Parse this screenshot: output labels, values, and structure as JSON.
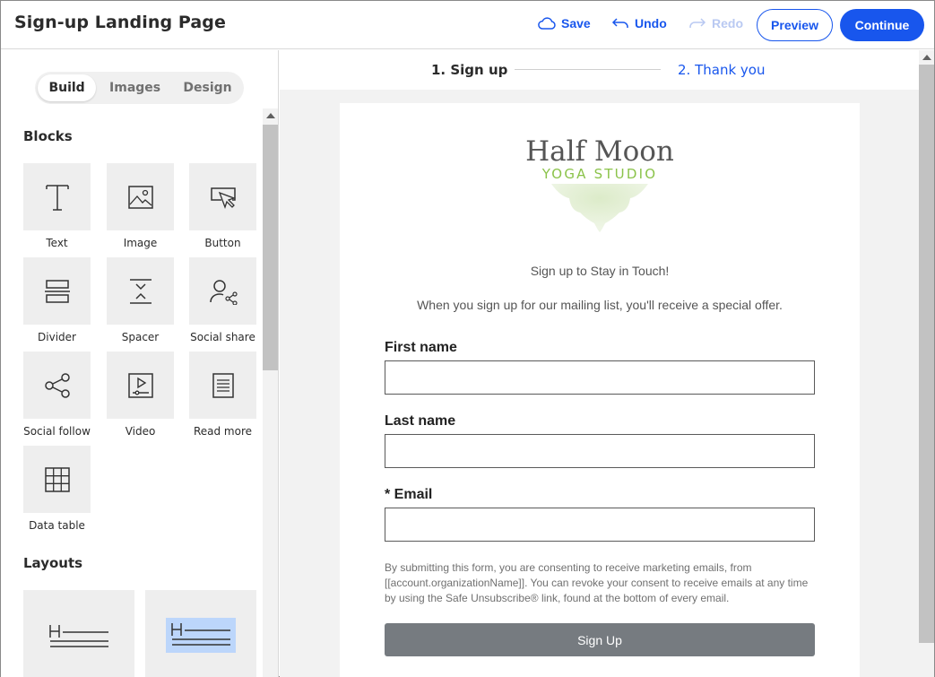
{
  "header": {
    "title": "Sign-up Landing Page",
    "save_label": "Save",
    "undo_label": "Undo",
    "redo_label": "Redo",
    "preview_label": "Preview",
    "continue_label": "Continue",
    "accent_color": "#1856ed"
  },
  "sidebar": {
    "tabs": [
      {
        "label": "Build",
        "active": true
      },
      {
        "label": "Images",
        "active": false
      },
      {
        "label": "Design",
        "active": false
      }
    ],
    "blocks_title": "Blocks",
    "blocks": [
      {
        "label": "Text",
        "icon": "text-icon"
      },
      {
        "label": "Image",
        "icon": "image-icon"
      },
      {
        "label": "Button",
        "icon": "button-icon"
      },
      {
        "label": "Divider",
        "icon": "divider-icon"
      },
      {
        "label": "Spacer",
        "icon": "spacer-icon"
      },
      {
        "label": "Social share",
        "icon": "social-share-icon"
      },
      {
        "label": "Social follow",
        "icon": "social-follow-icon"
      },
      {
        "label": "Video",
        "icon": "video-icon"
      },
      {
        "label": "Read more",
        "icon": "read-more-icon"
      },
      {
        "label": "Data table",
        "icon": "data-table-icon"
      }
    ],
    "layouts_title": "Layouts",
    "layouts": [
      {
        "icon": "heading-lines-icon",
        "highlighted": false
      },
      {
        "icon": "heading-lines-icon",
        "highlighted": true
      }
    ]
  },
  "steps": {
    "step1": "1.  Sign up",
    "step2": "2.  Thank you"
  },
  "landing": {
    "logo_line1": "Half Moon",
    "logo_line2": "YOGA STUDIO",
    "headline": "Sign up to Stay in Touch!",
    "subline": "When you sign up for our mailing list, you'll receive a special offer.",
    "fields": [
      {
        "label": "First name",
        "value": ""
      },
      {
        "label": "Last name",
        "value": ""
      },
      {
        "label": "* Email",
        "value": ""
      }
    ],
    "consent": "By submitting this form, you are consenting to receive marketing emails, from [[account.organizationName]]. You can revoke your consent to receive emails at any time by using the Safe Unsubscribe® link, found at the bottom of every email.",
    "submit_label": "Sign Up"
  }
}
